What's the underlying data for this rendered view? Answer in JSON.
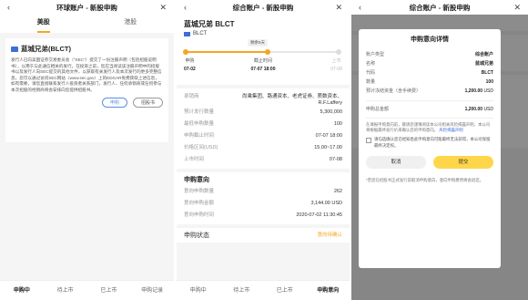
{
  "panel1": {
    "nav": {
      "title": "环球账户 - 新股申购",
      "back": "‹",
      "close": "✕"
    },
    "tabs": [
      "美股",
      "港股"
    ],
    "card": {
      "title": "蓝城兄弟(BLCT)",
      "desc": "发行人已向美国证券交易委员会（\"SEC\"）提交了一份注册声明（包括招股说明书），以用于与此通信相关的发行。在投资之前，您应当阅读该注册声明中的招股书以及发行人向SEC提交的其他文件，以获取有关发行人及本次发行的更多完整信息。您可以通过访问SEC网站（www.sec.gov）上的EDGAR免费获取上述信息，如有需要，请您直接联系发行人投资者关系部门，发行人、任何承销商或任何参与本次招股的经销商将会安排向您提供招股书。",
      "btn_subscribe": "申购",
      "btn_prospectus": "招股书"
    },
    "tabbar": [
      "申购中",
      "待上市",
      "已上市",
      "申购记录"
    ]
  },
  "panel2": {
    "nav": {
      "title": "综合账户 - 新股申购",
      "back": "‹",
      "close": "✕"
    },
    "stock": {
      "name": "蓝城兄弟 BLCT",
      "code": "BLCT"
    },
    "timeline": {
      "remain": "剩余5天",
      "steps": [
        {
          "label": "申购",
          "date": "07-02"
        },
        {
          "label": "截止时间",
          "date": "07-07 18:00"
        },
        {
          "label": "上市",
          "date": "07-08"
        }
      ]
    },
    "info": [
      {
        "k": "承销商",
        "v": "尚乘集团、路通资本、老虎证券、质数资本、R.F.Laffery"
      },
      {
        "k": "预计发行数量",
        "v": "5,300,000"
      },
      {
        "k": "最低申购数量",
        "v": "100"
      },
      {
        "k": "申购截止时间",
        "v": "07-07 18:00"
      },
      {
        "k": "价格区间(USD)",
        "v": "15.00~17.00"
      },
      {
        "k": "上市时间",
        "v": "07-08"
      }
    ],
    "intent": {
      "title": "申购意向",
      "rows": [
        {
          "k": "意向申购数量",
          "v": "262"
        },
        {
          "k": "意向申购金额",
          "v": "3,144.00 USD"
        },
        {
          "k": "意向申购时间",
          "v": "2020-07-02 11:30:45"
        }
      ]
    },
    "status": {
      "title": "申购状态",
      "value": "意向待确认"
    },
    "tabbar": [
      "申购中",
      "待上市",
      "已上市",
      "申购意向"
    ]
  },
  "panel3": {
    "nav": {
      "title": "综合账户 - 新股申购",
      "back": "‹",
      "close": "✕"
    },
    "modal": {
      "title": "申购意向详情",
      "rows": [
        {
          "k": "账户类型",
          "v": "综合账户"
        },
        {
          "k": "名称",
          "v": "蓝城兄弟"
        },
        {
          "k": "代码",
          "v": "BLCT"
        },
        {
          "k": "数量",
          "v": "100"
        }
      ],
      "frozen": {
        "k": "预计冻结资金（含手续费）",
        "v": "1,200.00",
        "u": "USD"
      },
      "amount": {
        "k": "申购总金额",
        "v": "1,200.00",
        "u": "USD"
      },
      "note": "在填报申购意向前，敬请您谨慎阅读本公司相关风险揭露声明，本公司将根据最终发行价来确认您的申购意向。",
      "note_link": "风险揭露声明",
      "check": "请勾选确认您已经知悉此申购意向可能最终无法获得，本公司保留最终决定权。",
      "cancel": "取消",
      "ok": "提交",
      "foot": "*若您在招股书正式发行前取消申购意向，意向申购费用将会退还。"
    }
  }
}
